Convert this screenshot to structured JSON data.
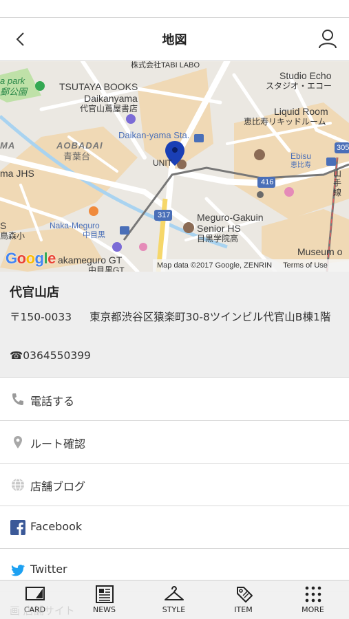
{
  "header": {
    "title": "地図"
  },
  "map": {
    "labels": {
      "tabi_labo": "株式会社TABI LABO",
      "tsutaya_en": "TSUTAYA BOOKS",
      "tsutaya_en2": "Daikanyama",
      "tsutaya_jp": "代官山蔦屋書店",
      "park_en": "a park",
      "park_jp": "郵公園",
      "daikanyama_sta": "Daikan-yama Sta.",
      "unit": "UNIT",
      "aobadai_en": "AOBADAI",
      "aobadai_jp": "青葉台",
      "ma": "MA",
      "ma_jhs": "ma JHS",
      "studio_echo_en": "Studio Echo",
      "studio_echo_jp": "スタジオ・エコー",
      "liquid_en": "Liquid Room",
      "liquid_jp": "恵比寿リキッドルーム",
      "ebisu_en": "Ebisu",
      "ebisu_jp": "恵比寿",
      "route_416": "416",
      "route_305": "305",
      "yamanote": "山手線",
      "meguro_gakuin_en1": "Meguro-Gakuin",
      "meguro_gakuin_en2": "Senior HS",
      "meguro_gakuin_jp": "目黒学院高",
      "naka_meguro_en": "Naka-Meguro",
      "naka_meguro_jp": "中目黒",
      "route_317": "317",
      "s": "S",
      "forest_jp": "鳥森小",
      "nakameguro_gt": "akameguro GT",
      "nakameguro_gt2": "中目黒GT",
      "museum": "Museum o"
    },
    "logo": "Google",
    "attribution": "Map data ©2017 Google, ZENRIN",
    "terms": "Terms of Use"
  },
  "store": {
    "name": "代官山店",
    "zip": "〒150-0033",
    "address": "東京都渋谷区猿楽町30-8ツインビル代官山B棟1階",
    "tel": "☎0364550399"
  },
  "menu": [
    {
      "label": "電話する",
      "icon": "phone-icon"
    },
    {
      "label": "ルート確認",
      "icon": "location-pin-icon"
    },
    {
      "label": "店舗ブログ",
      "icon": "globe-icon"
    },
    {
      "label": "Facebook",
      "icon": "facebook-icon"
    },
    {
      "label": "Twitter",
      "icon": "twitter-icon"
    }
  ],
  "ghost_text": "画 店舗サイト",
  "tabbar": [
    {
      "label": "CARD",
      "icon": "card-icon"
    },
    {
      "label": "NEWS",
      "icon": "news-icon"
    },
    {
      "label": "STYLE",
      "icon": "hanger-icon"
    },
    {
      "label": "ITEM",
      "icon": "tag-icon"
    },
    {
      "label": "MORE",
      "icon": "more-dots-icon"
    }
  ],
  "colors": {
    "facebook": "#3b5998",
    "twitter": "#1da1f2",
    "pin": "#1a3fb5",
    "map_bg": "#ebe8e2",
    "map_area": "#f0d9b5"
  }
}
